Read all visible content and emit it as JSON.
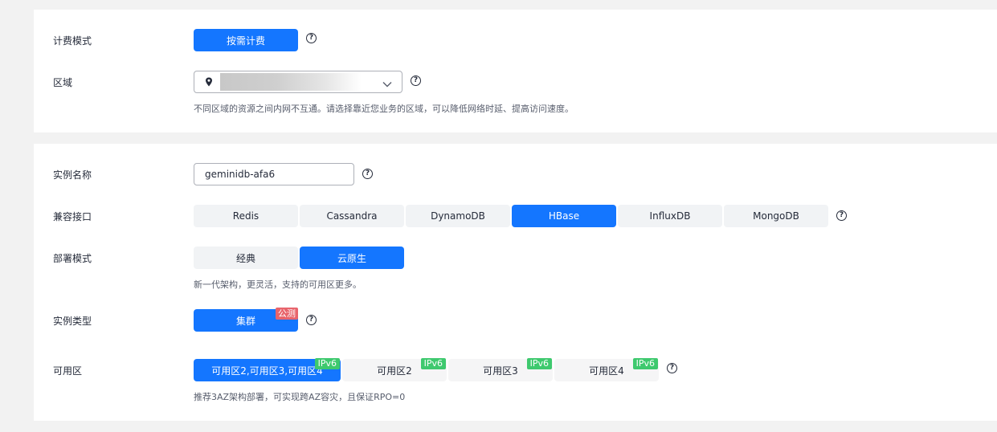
{
  "billing": {
    "label": "计费模式",
    "value": "按需计费"
  },
  "region": {
    "label": "区域",
    "hint": "不同区域的资源之间内网不互通。请选择靠近您业务的区域，可以降低网络时延、提高访问速度。"
  },
  "instance_name": {
    "label": "实例名称",
    "value": "geminidb-afa6"
  },
  "api": {
    "label": "兼容接口",
    "options": [
      "Redis",
      "Cassandra",
      "DynamoDB",
      "HBase",
      "InfluxDB",
      "MongoDB"
    ],
    "selected": "HBase"
  },
  "deploy": {
    "label": "部署模式",
    "options": [
      "经典",
      "云原生"
    ],
    "selected": "云原生",
    "hint": "新一代架构，更灵活，支持的可用区更多。"
  },
  "instance_type": {
    "label": "实例类型",
    "value": "集群",
    "tag": "公测"
  },
  "az": {
    "label": "可用区",
    "options": [
      "可用区2,可用区3,可用区4",
      "可用区2",
      "可用区3",
      "可用区4"
    ],
    "tag": "IPv6",
    "selected": "可用区2,可用区3,可用区4",
    "hint": "推荐3AZ架构部署，可实现跨AZ容灾，且保证RPO=0"
  },
  "colors": {
    "primary": "#1476ff",
    "ipv6_tag": "#3ec96e",
    "beta_tag": "#e8646c",
    "segment_bg": "#f1f3f5"
  },
  "icons": {
    "help": "question-circle-icon",
    "location": "location-pin-icon",
    "dropdown": "chevron-down-icon"
  }
}
